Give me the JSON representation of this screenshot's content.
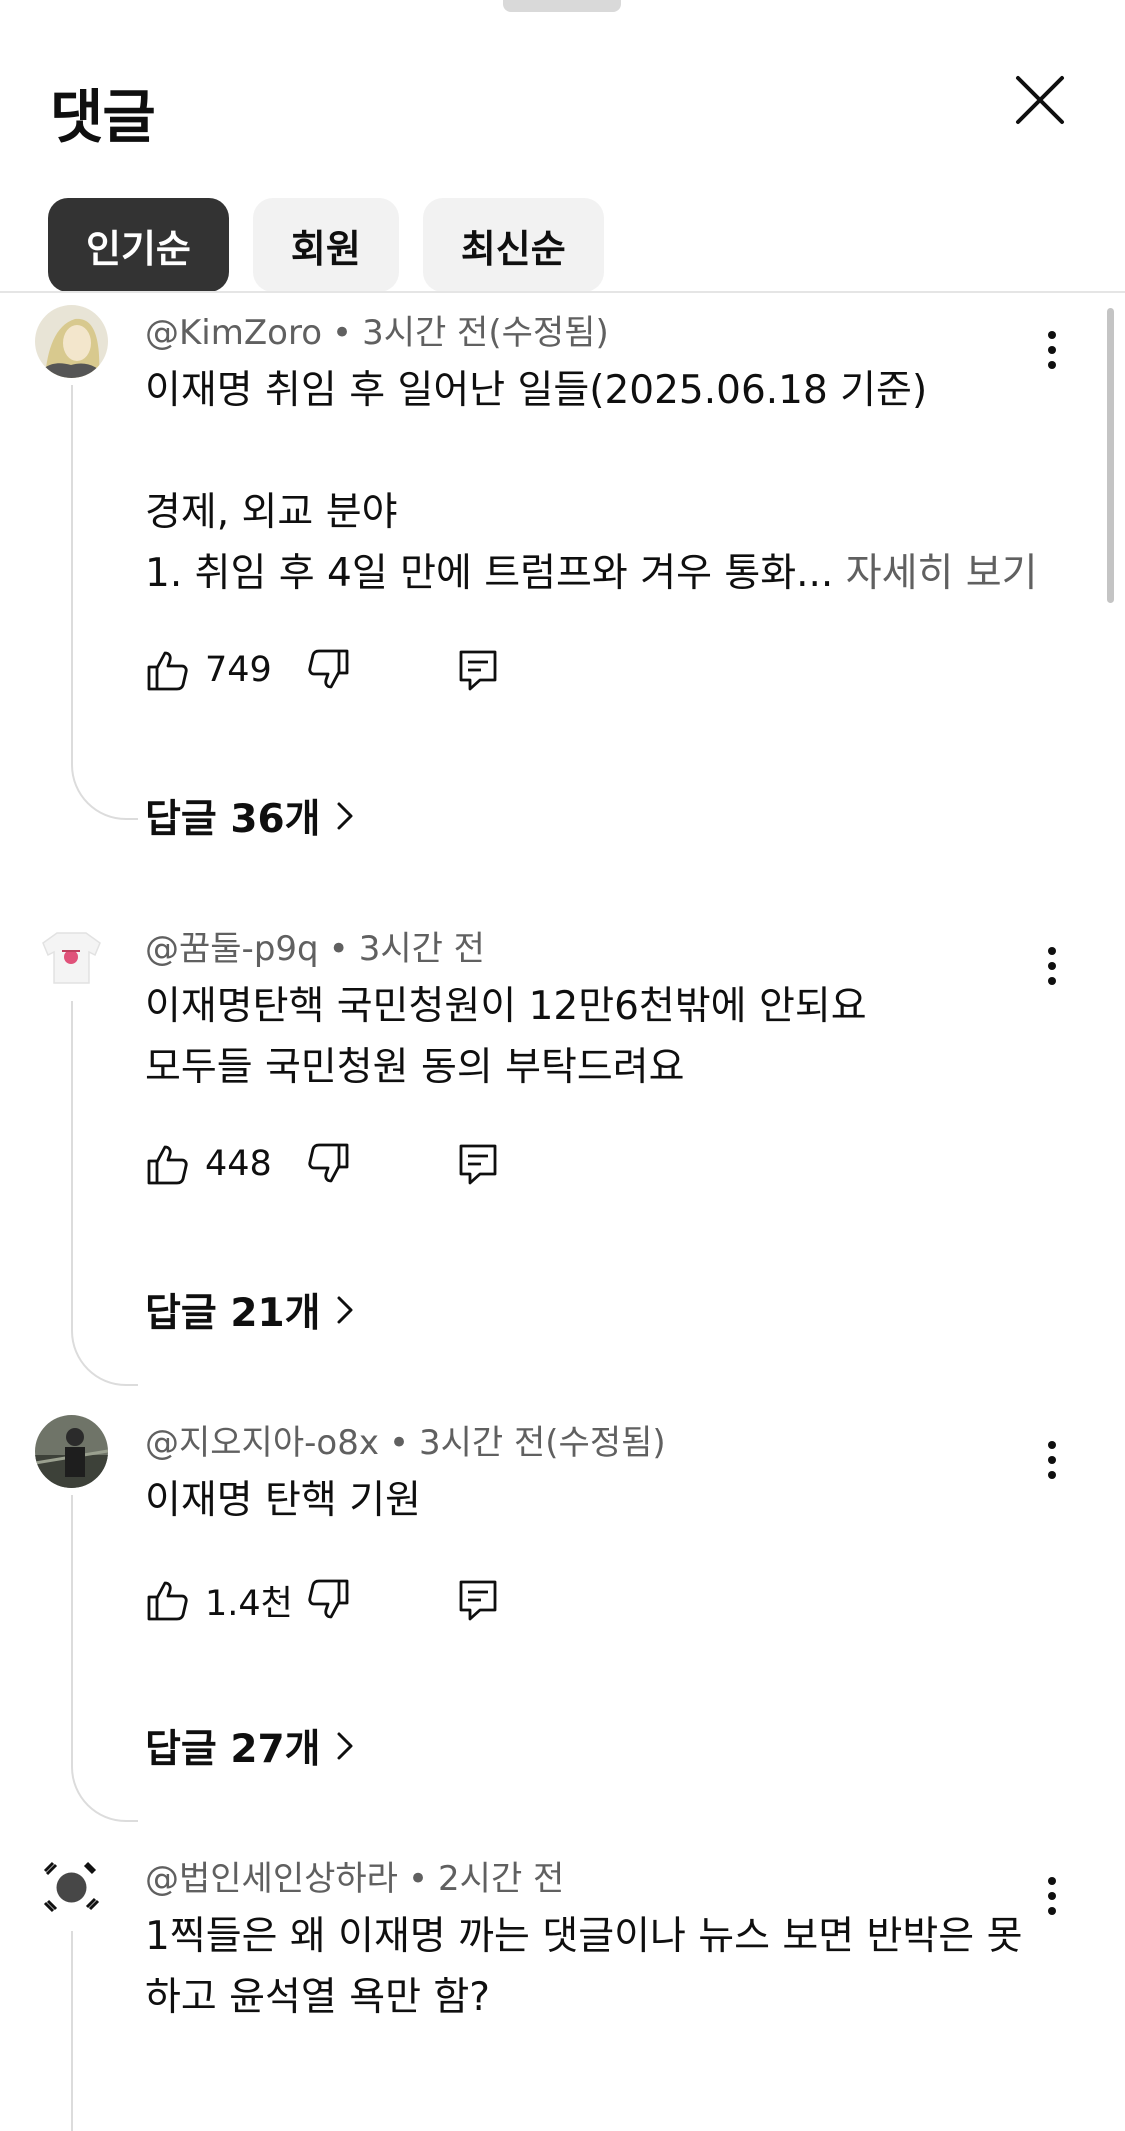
{
  "sheet": {
    "title": "댓글"
  },
  "filters": [
    {
      "label": "인기순",
      "active": true
    },
    {
      "label": "회원",
      "active": false
    },
    {
      "label": "최신순",
      "active": false
    }
  ],
  "comments": [
    {
      "author": "@KimZoro",
      "time": "3시간 전(수정됨)",
      "lines": [
        "이재명 취임 후 일어난 일들(2025.06.18 기준)",
        "",
        "경제, 외교 분야",
        "1. 취임 후 4일 만에 트럼프와 겨우 통화..."
      ],
      "more": " 자세히 보기",
      "likes": "749",
      "replies": "답글 36개"
    },
    {
      "author": "@꿈둘-p9q",
      "time": "3시간 전",
      "lines": [
        "이재명탄핵 국민청원이 12만6천밖에 안되요",
        "모두들 국민청원 동의 부탁드려요"
      ],
      "likes": "448",
      "replies": "답글 21개"
    },
    {
      "author": "@지오지아-o8x",
      "time": "3시간 전(수정됨)",
      "lines": [
        "이재명 탄핵 기원"
      ],
      "likes": "1.4천",
      "replies": "답글 27개"
    },
    {
      "author": "@법인세인상하라",
      "time": "2시간 전",
      "lines": [
        "1찍들은 왜 이재명 까는 댓글이나 뉴스 보면 반박은 못",
        "하고 윤석열 욕만 함?"
      ]
    }
  ],
  "icons": {
    "close": "close-icon",
    "like": "thumbs-up-icon",
    "dislike": "thumbs-down-icon",
    "reply": "reply-icon",
    "menu": "more-vert-icon",
    "replies_chevron": "chevron-right-icon"
  }
}
